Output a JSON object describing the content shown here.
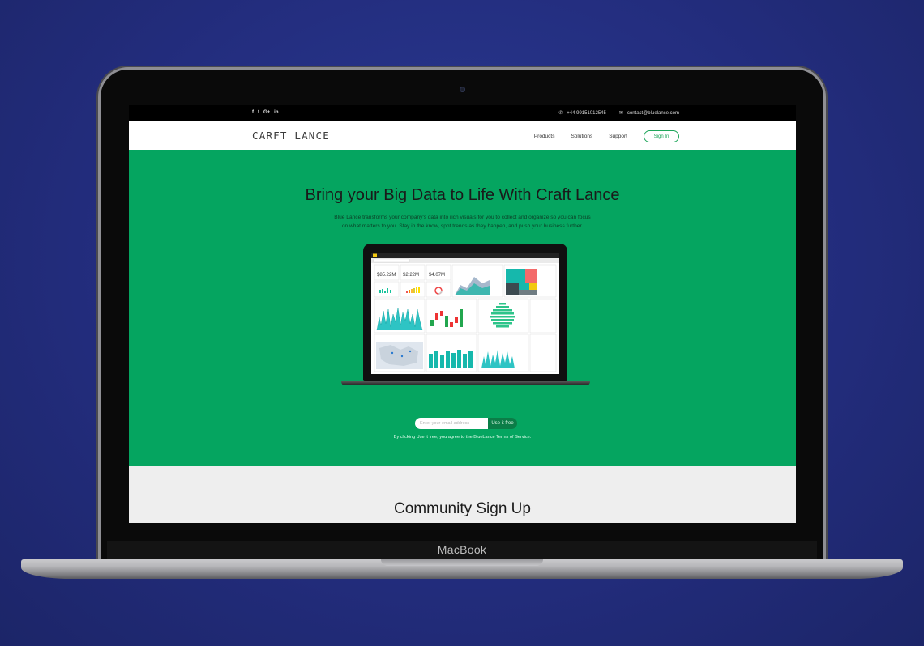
{
  "device": {
    "brand_label": "MacBook"
  },
  "topbar": {
    "social_icons": [
      "facebook-icon",
      "twitter-icon",
      "google-plus-icon",
      "linkedin-icon"
    ],
    "social_glyphs": [
      "f",
      "t",
      "G+",
      "in"
    ],
    "phone": "+44 99151012545",
    "email": "contact@bluelance.com"
  },
  "nav": {
    "logo": "CARFT LANCE",
    "links": [
      "Products",
      "Solutions",
      "Support"
    ],
    "signin_label": "Sign In"
  },
  "hero": {
    "title": "Bring your Big Data to Life With Craft Lance",
    "description_line1": "Blue Lance transforms your company's data into rich visuals for you to collect and organize so you can focus",
    "description_line2": "on what matters to you. Stay in the know, spot trends as they happen, and push your business further.",
    "dashboard_kpis": [
      "$85.22M",
      "$2.22M",
      "$4.07M"
    ],
    "email_placeholder": "Enter your email address",
    "cta_label": "Use it free",
    "terms": "By clicking Use it free, you agree to the BlueLance Terms of Service."
  },
  "community": {
    "title": "Community Sign Up"
  },
  "colors": {
    "background": "#232d7e",
    "hero_green": "#05a560",
    "accent_green": "#1ea65a",
    "cta_dark_green": "#0b7d47",
    "community_bg": "#eeeeee"
  }
}
